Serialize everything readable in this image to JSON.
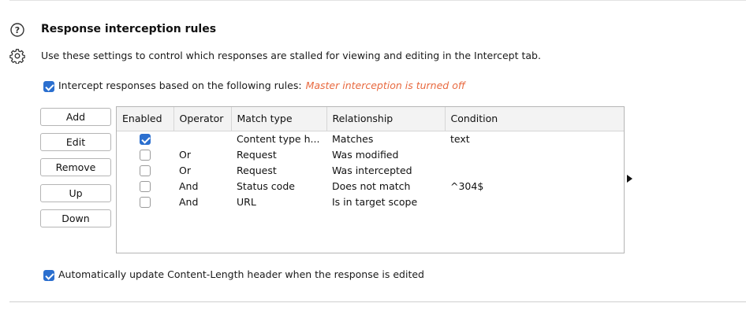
{
  "section": {
    "title": "Response interception rules",
    "description": "Use these settings to control which responses are stalled for viewing and editing in the Intercept tab."
  },
  "intercept": {
    "checked": true,
    "label": "Intercept responses based on the following rules:",
    "warning": "Master interception is turned off"
  },
  "buttons": {
    "add": "Add",
    "edit": "Edit",
    "remove": "Remove",
    "up": "Up",
    "down": "Down"
  },
  "table": {
    "columns": [
      "Enabled",
      "Operator",
      "Match type",
      "Relationship",
      "Condition"
    ],
    "rows": [
      {
        "enabled": true,
        "operator": "",
        "match_type": "Content type h...",
        "relationship": "Matches",
        "condition": "text"
      },
      {
        "enabled": false,
        "operator": "Or",
        "match_type": "Request",
        "relationship": "Was modified",
        "condition": ""
      },
      {
        "enabled": false,
        "operator": "Or",
        "match_type": "Request",
        "relationship": "Was intercepted",
        "condition": ""
      },
      {
        "enabled": false,
        "operator": "And",
        "match_type": "Status code",
        "relationship": "Does not match",
        "condition": "^304$"
      },
      {
        "enabled": false,
        "operator": "And",
        "match_type": "URL",
        "relationship": "Is in target scope",
        "condition": ""
      }
    ]
  },
  "auto_update": {
    "checked": true,
    "label": "Automatically update Content-Length header when the response is edited"
  },
  "colors": {
    "accent": "#2b6fcf",
    "warning": "#e8693f"
  },
  "icons": {
    "help": "help-circle-icon",
    "settings": "gear-icon",
    "expand": "triangle-right-icon"
  }
}
